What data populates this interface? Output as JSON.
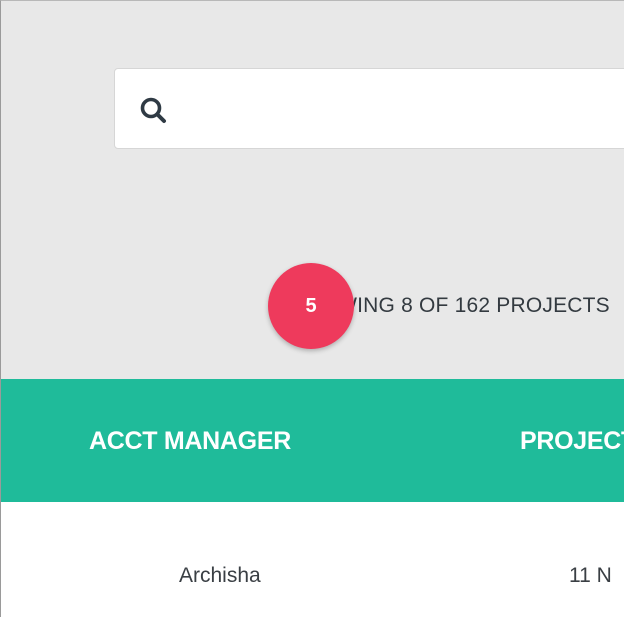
{
  "search": {
    "placeholder": "",
    "value": ""
  },
  "results": {
    "summary": "SHOWING 8 OF 162 PROJECTS"
  },
  "step_badge": {
    "number": "5",
    "color": "#ee3a5c"
  },
  "table": {
    "header_color": "#1fbb9a",
    "columns": [
      "ACCT MANAGER",
      "PROJECT"
    ],
    "rows": [
      {
        "acct_manager": "Archisha",
        "project": "11 N"
      }
    ]
  }
}
